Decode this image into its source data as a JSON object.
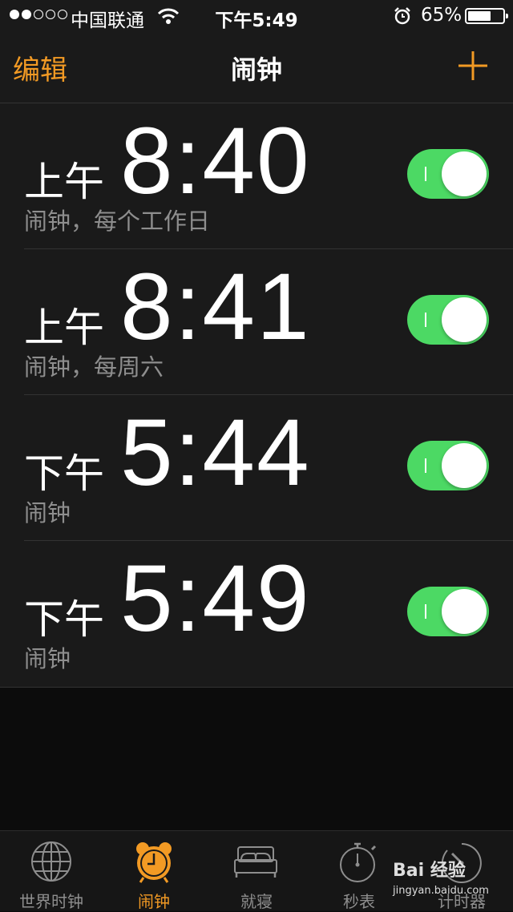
{
  "status_bar": {
    "carrier": "中国联通",
    "time": "下午5:49",
    "battery_percent": "65%",
    "battery_level": 0.65,
    "signal_bars_filled": 2,
    "signal_bars_total": 5
  },
  "nav": {
    "edit_label": "编辑",
    "title": "闹钟",
    "add_icon": "plus-icon"
  },
  "alarms": [
    {
      "ampm": "上午",
      "time": "8:40",
      "label": "闹钟，每个工作日",
      "enabled": true
    },
    {
      "ampm": "上午",
      "time": "8:41",
      "label": "闹钟，每周六",
      "enabled": true
    },
    {
      "ampm": "下午",
      "time": "5:44",
      "label": "闹钟",
      "enabled": true
    },
    {
      "ampm": "下午",
      "time": "5:49",
      "label": "闹钟",
      "enabled": true
    }
  ],
  "tabs": [
    {
      "label": "世界时钟",
      "icon": "globe-icon",
      "active": false
    },
    {
      "label": "闹钟",
      "icon": "alarm-clock-icon",
      "active": true
    },
    {
      "label": "就寝",
      "icon": "bed-icon",
      "active": false
    },
    {
      "label": "秒表",
      "icon": "stopwatch-icon",
      "active": false
    },
    {
      "label": "计时器",
      "icon": "timer-icon",
      "active": false
    }
  ],
  "watermark": {
    "text": "Bai 经验",
    "url": "jingyan.baidu.com"
  },
  "colors": {
    "accent": "#f29a24",
    "toggle_on": "#4cd964",
    "background": "#1a1a1a",
    "secondary_text": "#8e8e8e"
  }
}
